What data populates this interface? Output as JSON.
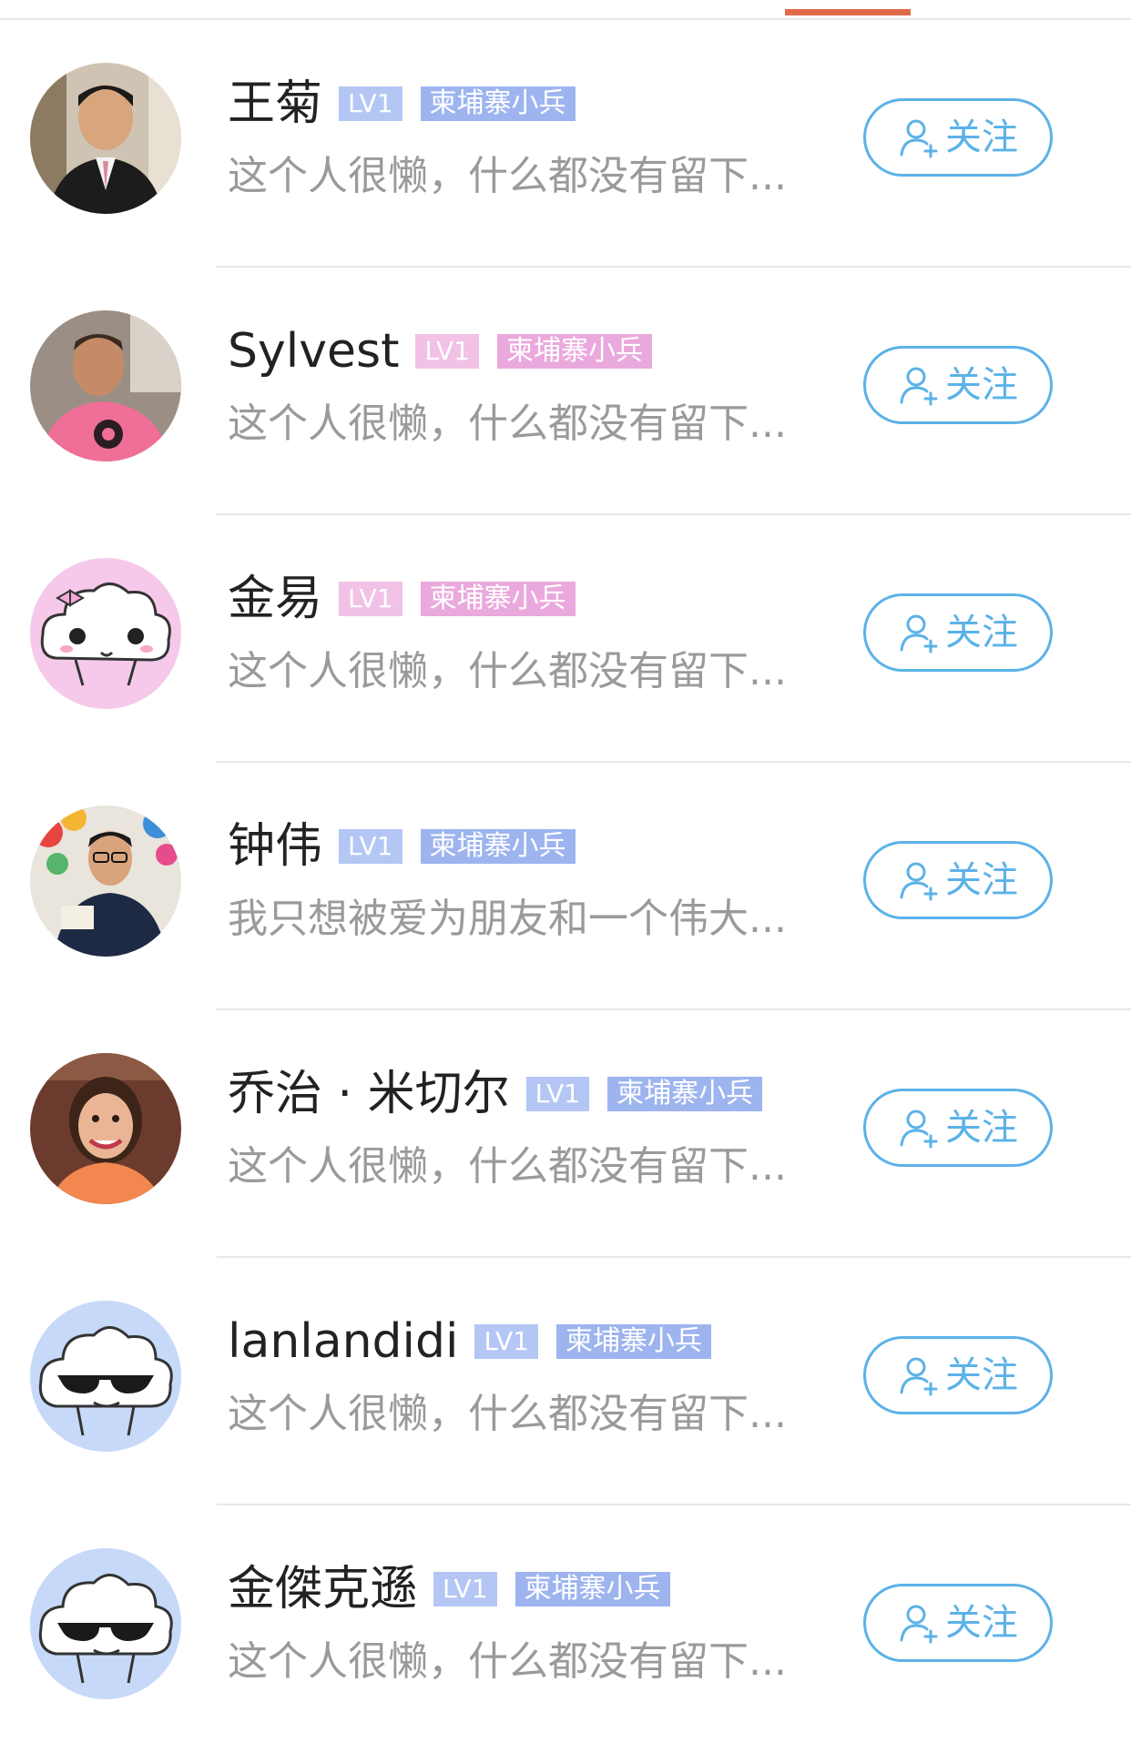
{
  "follow_label": "关注",
  "colors": {
    "tab_indicator": "#e06a4a",
    "follow_accent": "#5bb2e8",
    "badge_blue": "#9db4ef",
    "badge_pink": "#eaa9dc"
  },
  "users": [
    {
      "name": "王菊",
      "level": "LV1",
      "title": "柬埔寨小兵",
      "bio": "这个人很懒，什么都没有留下...",
      "badge_color": "blue",
      "avatar": "photo-man-suit-avatar"
    },
    {
      "name": "Sylvest",
      "level": "LV1",
      "title": "柬埔寨小兵",
      "bio": "这个人很懒，什么都没有留下...",
      "badge_color": "pink",
      "avatar": "photo-man-pink-shirt-avatar"
    },
    {
      "name": "金易",
      "level": "LV1",
      "title": "柬埔寨小兵",
      "bio": "这个人很懒，什么都没有留下...",
      "badge_color": "pink",
      "avatar": "cloud-girl-avatar"
    },
    {
      "name": "钟伟",
      "level": "LV1",
      "title": "柬埔寨小兵",
      "bio": "我只想被爱为朋友和一个伟大...",
      "badge_color": "blue",
      "avatar": "photo-man-balloons-avatar"
    },
    {
      "name": "乔治 · 米切尔",
      "level": "LV1",
      "title": "柬埔寨小兵",
      "bio": "这个人很懒，什么都没有留下...",
      "badge_color": "blue",
      "avatar": "photo-girl-avatar"
    },
    {
      "name": "lanlandidi",
      "level": "LV1",
      "title": "柬埔寨小兵",
      "bio": "这个人很懒，什么都没有留下...",
      "badge_color": "blue",
      "avatar": "cloud-sunglasses-avatar"
    },
    {
      "name": "金傑克遜",
      "level": "LV1",
      "title": "柬埔寨小兵",
      "bio": "这个人很懒，什么都没有留下...",
      "badge_color": "blue",
      "avatar": "cloud-sunglasses-avatar"
    }
  ]
}
